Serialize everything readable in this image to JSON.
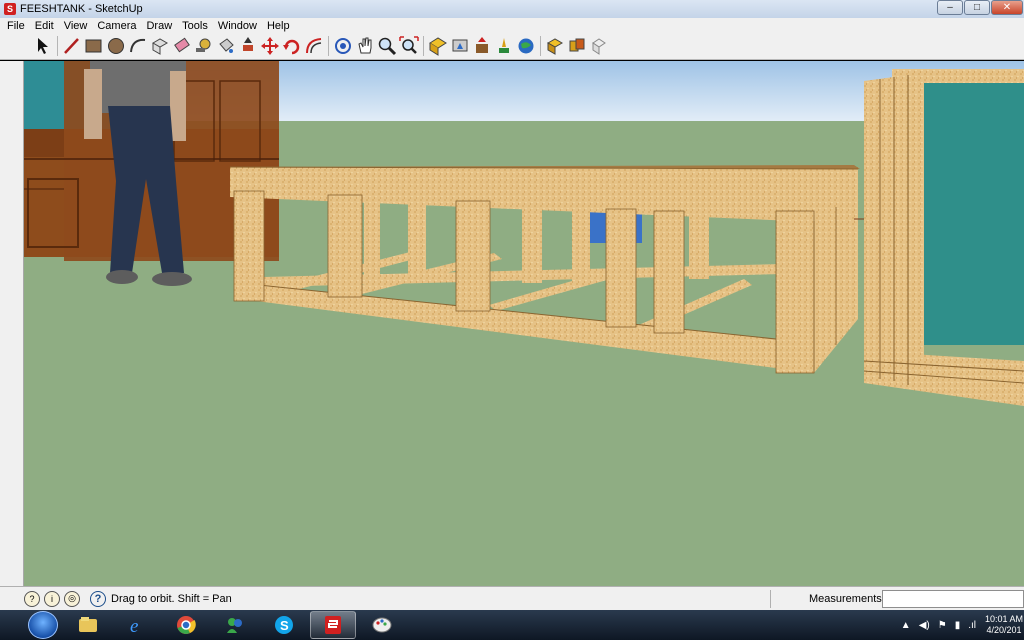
{
  "window": {
    "title": "FEESHTANK - SketchUp",
    "app_icon_glyph": "S",
    "controls": {
      "minimize": "–",
      "maximize": "□",
      "close": "✕"
    }
  },
  "menu": [
    "File",
    "Edit",
    "View",
    "Camera",
    "Draw",
    "Tools",
    "Window",
    "Help"
  ],
  "toolbar": {
    "tools": [
      {
        "name": "select-icon"
      },
      {
        "sep": true
      },
      {
        "name": "line-icon"
      },
      {
        "name": "rectangle-icon"
      },
      {
        "name": "circle-icon"
      },
      {
        "name": "arc-icon"
      },
      {
        "name": "make-component-icon"
      },
      {
        "name": "eraser-icon"
      },
      {
        "name": "tape-measure-icon"
      },
      {
        "name": "paint-bucket-icon"
      },
      {
        "name": "push-pull-icon"
      },
      {
        "name": "move-icon"
      },
      {
        "name": "rotate-icon"
      },
      {
        "name": "offset-icon"
      },
      {
        "sep": true
      },
      {
        "name": "orbit-icon"
      },
      {
        "name": "pan-icon"
      },
      {
        "name": "zoom-icon"
      },
      {
        "name": "zoom-extents-icon"
      },
      {
        "sep": true
      },
      {
        "name": "3d-warehouse-icon"
      },
      {
        "name": "share-model-icon"
      },
      {
        "name": "get-models-icon"
      },
      {
        "name": "place-model-icon"
      },
      {
        "name": "google-earth-icon"
      },
      {
        "sep": true
      },
      {
        "name": "components-icon"
      },
      {
        "name": "styles-icon"
      },
      {
        "name": "extension-icon"
      }
    ]
  },
  "status": {
    "text": "Drag to orbit.  Shift = Pan",
    "measurements_label": "Measurements",
    "measurements_value": ""
  },
  "taskbar": {
    "apps": [
      {
        "name": "explorer-icon",
        "active": false
      },
      {
        "name": "internet-explorer-icon",
        "active": false
      },
      {
        "name": "chrome-icon",
        "active": false
      },
      {
        "name": "messenger-icon",
        "active": false
      },
      {
        "name": "skype-icon",
        "active": false
      },
      {
        "name": "sketchup-icon",
        "active": true
      },
      {
        "name": "paint-icon",
        "active": false
      }
    ],
    "clock_time": "10:01 AM",
    "clock_date": "4/20/201"
  },
  "colors": {
    "sky": "#bcd6ee",
    "ground": "#8fae84",
    "wood": "#e7c488",
    "wood_dark": "#c99a55",
    "cabinet": "#8b4a1e",
    "water": "#2f8f8a",
    "accent_blue": "#3a72c8"
  }
}
